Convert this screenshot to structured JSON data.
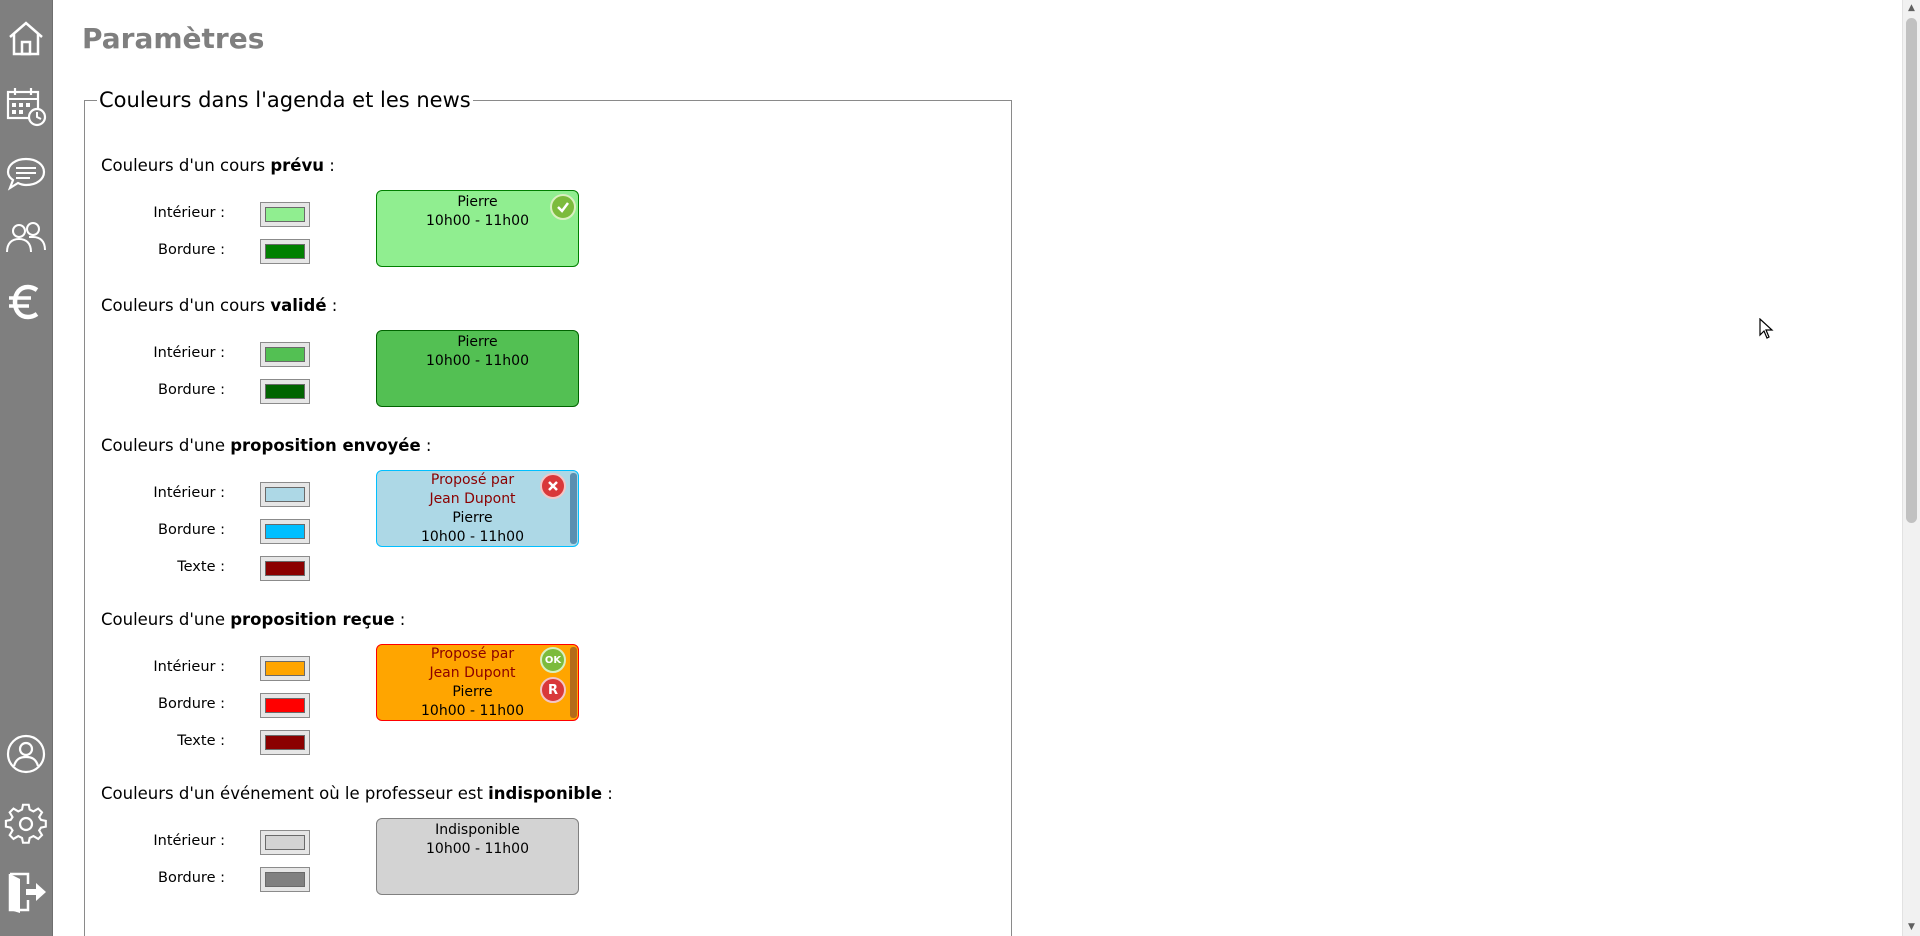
{
  "page": {
    "title": "Paramètres"
  },
  "sidebar": {
    "items": [
      {
        "name": "home-icon"
      },
      {
        "name": "calendar-icon"
      },
      {
        "name": "messages-icon"
      },
      {
        "name": "users-icon"
      },
      {
        "name": "euro-icon"
      },
      {
        "name": "profile-icon"
      },
      {
        "name": "settings-icon"
      },
      {
        "name": "logout-icon"
      }
    ]
  },
  "colors_group": {
    "legend": "Couleurs dans l'agenda et les news",
    "sections": [
      {
        "title_prefix": "Couleurs d'un cours ",
        "title_bold": "prévu",
        "title_suffix": " :",
        "rows": [
          {
            "label": "Intérieur :",
            "color": "#90ee90"
          },
          {
            "label": "Bordure :",
            "color": "#008000"
          }
        ],
        "preview": {
          "lines": [
            "Pierre",
            "10h00 - 11h00"
          ],
          "background": "#90ee90",
          "border": "#008000",
          "badges": [
            "check-badge"
          ]
        }
      },
      {
        "title_prefix": "Couleurs d'un cours ",
        "title_bold": "validé",
        "title_suffix": " :",
        "rows": [
          {
            "label": "Intérieur :",
            "color": "#53c053"
          },
          {
            "label": "Bordure :",
            "color": "#006400"
          }
        ],
        "preview": {
          "lines": [
            "Pierre",
            "10h00 - 11h00"
          ],
          "background": "#53c053",
          "border": "#006400",
          "badges": []
        }
      },
      {
        "title_prefix": "Couleurs d'une ",
        "title_bold": "proposition envoyée",
        "title_suffix": " :",
        "rows": [
          {
            "label": "Intérieur :",
            "color": "#add8e6"
          },
          {
            "label": "Bordure :",
            "color": "#00bfff"
          },
          {
            "label": "Texte :",
            "color": "#8b0000"
          }
        ],
        "preview": {
          "proposed_lines": [
            "Proposé par",
            "Jean Dupont"
          ],
          "lines": [
            "Pierre",
            "10h00 - 11h00"
          ],
          "background": "#add8e6",
          "border": "#00bfff",
          "text_color": "#8b0000",
          "badges": [
            "x-badge"
          ]
        }
      },
      {
        "title_prefix": "Couleurs d'une ",
        "title_bold": "proposition reçue",
        "title_suffix": " :",
        "rows": [
          {
            "label": "Intérieur :",
            "color": "#ffa500"
          },
          {
            "label": "Bordure :",
            "color": "#ff0000"
          },
          {
            "label": "Texte :",
            "color": "#8b0000"
          }
        ],
        "preview": {
          "proposed_lines": [
            "Proposé par",
            "Jean Dupont"
          ],
          "lines": [
            "Pierre",
            "10h00 - 11h00"
          ],
          "background": "#ffa500",
          "border": "#ff0000",
          "text_color": "#8b0000",
          "badges": [
            "ok-badge",
            "r-badge"
          ],
          "badge_labels": {
            "ok": "OK",
            "r": "R"
          }
        }
      },
      {
        "title_prefix": "Couleurs d'un événement où le professeur est ",
        "title_bold": "indisponible",
        "title_suffix": " :",
        "rows": [
          {
            "label": "Intérieur :",
            "color": "#d3d3d3"
          },
          {
            "label": "Bordure :",
            "color": "#808080"
          }
        ],
        "preview": {
          "lines": [
            "Indisponible",
            "10h00 - 11h00"
          ],
          "background": "#d3d3d3",
          "border": "#808080",
          "badges": []
        }
      }
    ]
  }
}
